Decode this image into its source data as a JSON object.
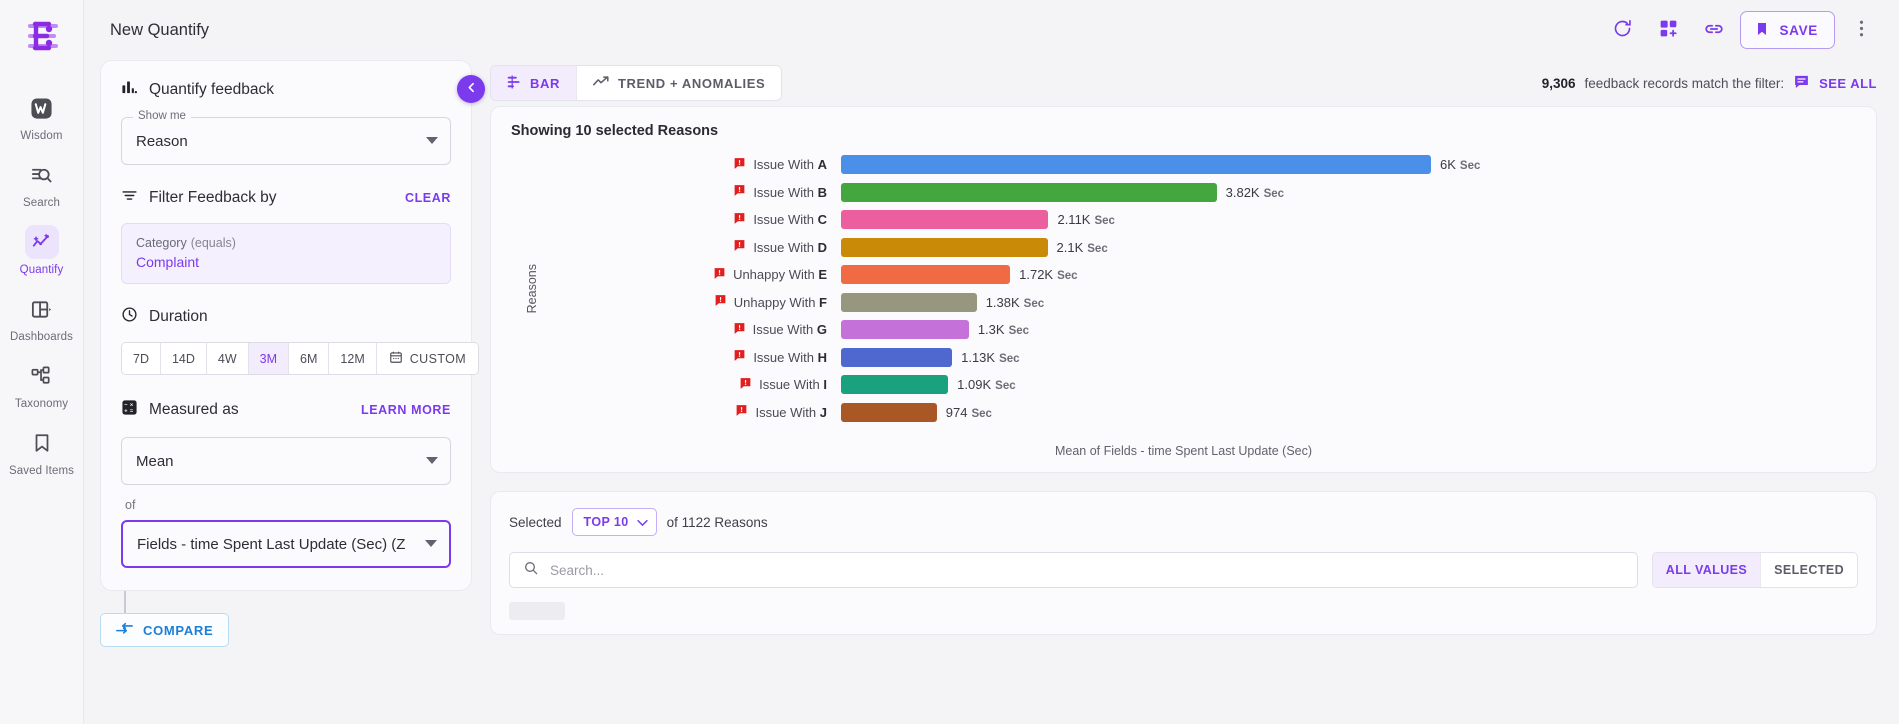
{
  "rail": {
    "logo_name": "app-logo",
    "items": [
      {
        "label": "Wisdom",
        "icon": "wisdom-icon",
        "active": false
      },
      {
        "label": "Search",
        "icon": "search-icon",
        "active": false
      },
      {
        "label": "Quantify",
        "icon": "quantify-icon",
        "active": true
      },
      {
        "label": "Dashboards",
        "icon": "dashboards-icon",
        "active": false
      },
      {
        "label": "Taxonomy",
        "icon": "taxonomy-icon",
        "active": false
      },
      {
        "label": "Saved Items",
        "icon": "bookmark-icon",
        "active": false
      }
    ]
  },
  "topbar": {
    "title": "New Quantify",
    "refresh_label": "refresh-icon",
    "add_widget_label": "add-widget-icon",
    "link_label": "link-icon",
    "save_label": "SAVE",
    "more_label": "more-options-icon"
  },
  "config": {
    "section_quantify": "Quantify feedback",
    "show_me_legend": "Show me",
    "show_me_value": "Reason",
    "section_filter": "Filter Feedback by",
    "clear_label": "CLEAR",
    "filter_chip_field": "Category",
    "filter_chip_operator": "(equals)",
    "filter_chip_value": "Complaint",
    "section_duration": "Duration",
    "durations": [
      {
        "label": "7D",
        "active": false
      },
      {
        "label": "14D",
        "active": false
      },
      {
        "label": "4W",
        "active": false
      },
      {
        "label": "3M",
        "active": true
      },
      {
        "label": "6M",
        "active": false
      },
      {
        "label": "12M",
        "active": false
      }
    ],
    "custom_label": "CUSTOM",
    "section_measured": "Measured as",
    "learn_more_label": "LEARN MORE",
    "measure_value": "Mean",
    "of_label": "of",
    "field_value": "Fields - time Spent Last Update (Sec) (Z",
    "compare_label": "COMPARE"
  },
  "viz": {
    "tabs": [
      {
        "label": "BAR",
        "icon": "bar-chart-icon",
        "active": true
      },
      {
        "label": "TREND + ANOMALIES",
        "icon": "trend-line-icon",
        "active": false
      }
    ],
    "records_count": "9,306",
    "records_text": "feedback records match the filter:",
    "feedback_icon": "feedback-comment-icon",
    "see_all_label": "SEE ALL"
  },
  "selection": {
    "selected_label": "Selected",
    "top_value": "TOP 10",
    "of_text": "of 1122 Reasons",
    "search_placeholder": "Search...",
    "search_value": "",
    "value_tabs": [
      {
        "label": "ALL VALUES",
        "active": true
      },
      {
        "label": "SELECTED",
        "active": false
      }
    ]
  },
  "chart_data": {
    "type": "bar",
    "orientation": "horizontal",
    "title": "Showing 10 selected Reasons",
    "ylabel": "Reasons",
    "xlabel": "",
    "footer": "Mean of Fields - time Spent Last Update (Sec)",
    "unit": "Sec",
    "xlim": [
      0,
      6000
    ],
    "grid": false,
    "legend": "none",
    "categories": [
      "Issue With A",
      "Issue With B",
      "Issue With C",
      "Issue With D",
      "Unhappy With E",
      "Unhappy With F",
      "Issue With G",
      "Issue With H",
      "Issue With I",
      "Issue With J"
    ],
    "values": [
      6000,
      3820,
      2110,
      2100,
      1720,
      1380,
      1300,
      1130,
      1090,
      974
    ],
    "value_labels": [
      "6K",
      "3.82K",
      "2.11K",
      "2.1K",
      "1.72K",
      "1.38K",
      "1.3K",
      "1.13K",
      "1.09K",
      "974"
    ],
    "colors": [
      "#4a90e8",
      "#44a63f",
      "#ec5f9e",
      "#c98a07",
      "#f06a43",
      "#97977f",
      "#c471d9",
      "#4e68cf",
      "#1aa27e",
      "#a85725"
    ],
    "bars": [
      {
        "label": "Issue With A",
        "prefix": "Issue With",
        "suffix": "A",
        "value": 6000,
        "value_label": "6K",
        "color": "#4a90e8"
      },
      {
        "label": "Issue With B",
        "prefix": "Issue With",
        "suffix": "B",
        "value": 3820,
        "value_label": "3.82K",
        "color": "#44a63f"
      },
      {
        "label": "Issue With C",
        "prefix": "Issue With",
        "suffix": "C",
        "value": 2110,
        "value_label": "2.11K",
        "color": "#ec5f9e"
      },
      {
        "label": "Issue With D",
        "prefix": "Issue With",
        "suffix": "D",
        "value": 2100,
        "value_label": "2.1K",
        "color": "#c98a07"
      },
      {
        "label": "Unhappy With E",
        "prefix": "Unhappy With",
        "suffix": "E",
        "value": 1720,
        "value_label": "1.72K",
        "color": "#f06a43"
      },
      {
        "label": "Unhappy With F",
        "prefix": "Unhappy With",
        "suffix": "F",
        "value": 1380,
        "value_label": "1.38K",
        "color": "#97977f"
      },
      {
        "label": "Issue With G",
        "prefix": "Issue With",
        "suffix": "G",
        "value": 1300,
        "value_label": "1.3K",
        "color": "#c471d9"
      },
      {
        "label": "Issue With H",
        "prefix": "Issue With",
        "suffix": "H",
        "value": 1130,
        "value_label": "1.13K",
        "color": "#4e68cf"
      },
      {
        "label": "Issue With I",
        "prefix": "Issue With",
        "suffix": "I",
        "value": 1090,
        "value_label": "1.09K",
        "color": "#1aa27e"
      },
      {
        "label": "Issue With J",
        "prefix": "Issue With",
        "suffix": "J",
        "value": 974,
        "value_label": "974",
        "color": "#a85725"
      }
    ]
  },
  "colors": {
    "accent": "#7c3aed",
    "accent_soft": "#f2ecfd",
    "compare_blue": "#1c7fd6",
    "flag_red": "#e02020"
  }
}
